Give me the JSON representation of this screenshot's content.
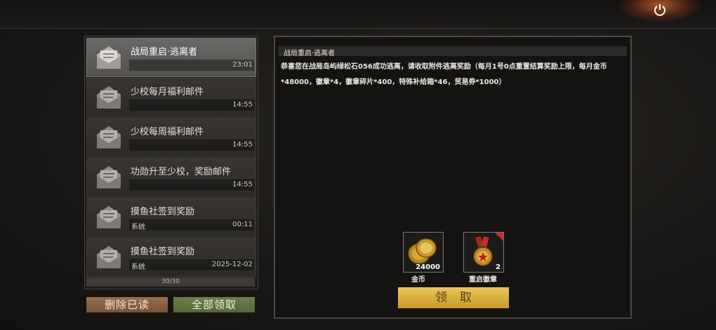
{
  "mail_list": {
    "items": [
      {
        "title": "战局重启·逃离者",
        "sender": "",
        "time": "23:01",
        "active": true
      },
      {
        "title": "少校每月福利邮件",
        "sender": "",
        "time": "14:55"
      },
      {
        "title": "少校每周福利邮件",
        "sender": "",
        "time": "14:55"
      },
      {
        "title": "功勋升至少校，奖励邮件",
        "sender": "",
        "time": "14:55"
      },
      {
        "title": "摸鱼社签到奖励",
        "sender": "系统",
        "time": "00:11"
      },
      {
        "title": "摸鱼社签到奖励",
        "sender": "系统",
        "time": "2025-12-02"
      }
    ],
    "count_label": "30/30"
  },
  "buttons": {
    "delete_read": "删除已读",
    "claim_all": "全部领取",
    "claim": "领取"
  },
  "detail": {
    "title": "战局重启·逃离者",
    "body": "恭喜您在战局岛屿绿松石056成功逃离，请收取附件逃离奖励（每月1号0点重置结算奖励上限，每月金币*48000，徽章*4，徽章碎片*400，特殊补给箱*46，贸易券*1000）",
    "rewards": [
      {
        "name": "金币",
        "count": "24000",
        "icon": "gold-coins-icon"
      },
      {
        "name": "重启徽章",
        "count": "2",
        "icon": "medal-icon"
      }
    ]
  },
  "colors": {
    "delete_button": "#8a6040",
    "claim_all_button": "#627243",
    "claim_button": "#dcb448"
  }
}
